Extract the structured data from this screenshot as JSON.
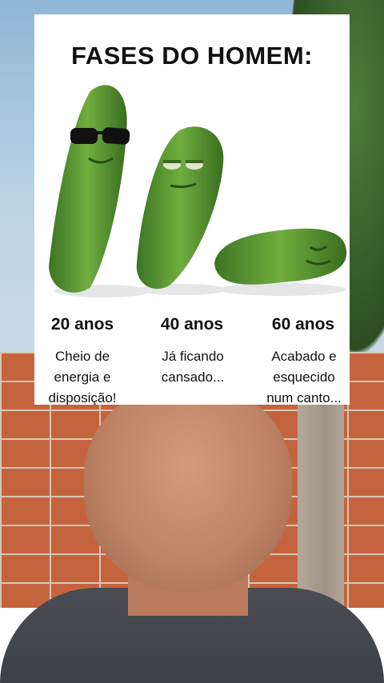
{
  "card": {
    "title": "FASES DO HOMEM:",
    "phases": [
      {
        "age": "20 anos",
        "description": "Cheio de\nenergia e\ndisposição!"
      },
      {
        "age": "40 anos",
        "description": "Já ficando\ncansado..."
      },
      {
        "age": "60 anos",
        "description": "Acabado e\nesquecido\nnum canto..."
      }
    ]
  },
  "colors": {
    "card_bg": "#ffffff",
    "cucumber_green": "#4e8a2c",
    "brick": "#c4643f",
    "shirt": "#3f4247"
  }
}
